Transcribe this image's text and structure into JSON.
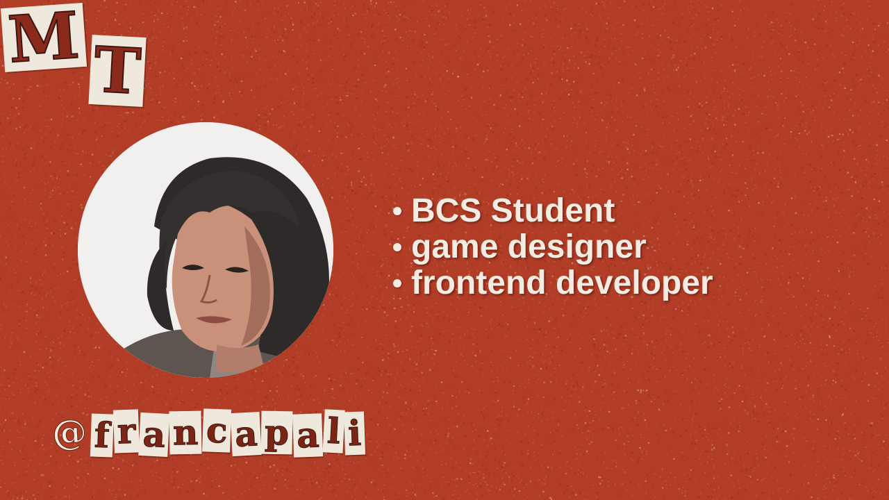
{
  "logo": {
    "letters": [
      "M",
      "T"
    ]
  },
  "avatar": {
    "icon": "profile-photo"
  },
  "bullets": [
    "BCS Student",
    "game designer",
    "frontend developer"
  ],
  "handle": "@francapali",
  "colors": {
    "background": "#b23d26",
    "text": "#f3ece3",
    "paper": "#efe9dd"
  }
}
